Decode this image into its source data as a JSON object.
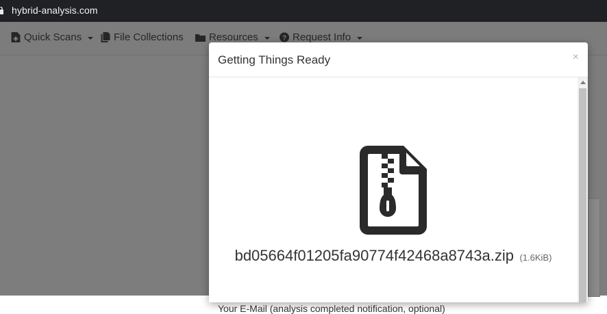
{
  "browser": {
    "url": "hybrid-analysis.com"
  },
  "navbar": {
    "items": [
      {
        "label": "Quick Scans",
        "icon": "file-plus-icon",
        "dropdown": true
      },
      {
        "label": "File Collections",
        "icon": "files-icon",
        "dropdown": false
      },
      {
        "label": "Resources",
        "icon": "folder-icon",
        "dropdown": true
      },
      {
        "label": "Request Info",
        "icon": "question-circle-icon",
        "dropdown": true
      }
    ]
  },
  "modal": {
    "title": "Getting Things Ready",
    "close_label": "×",
    "file_icon": "file-zip-icon",
    "file_name": "bd05664f01205fa90774f42468a8743a.zip",
    "file_size": "(1.6KiB)",
    "email_label": "Your E-Mail (analysis completed notification, optional)"
  }
}
